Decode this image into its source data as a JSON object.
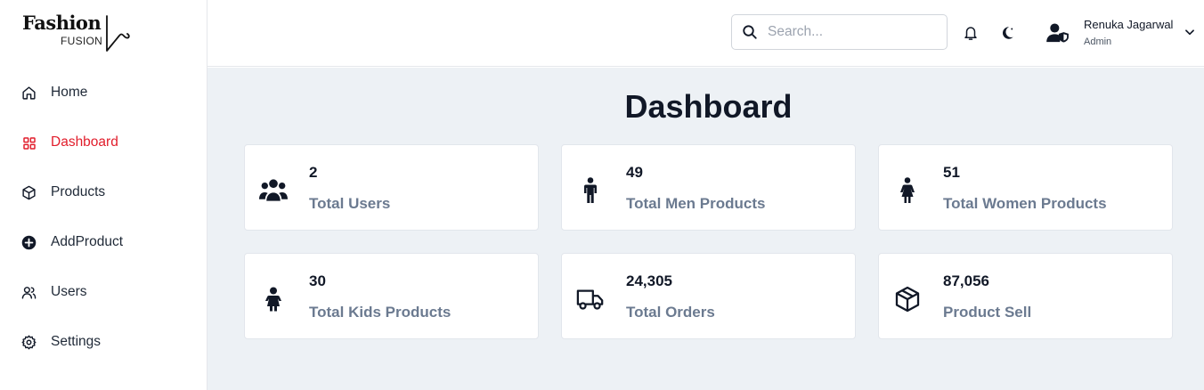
{
  "brand": {
    "name": "Fashion",
    "subtitle": "FUSION"
  },
  "sidebar": {
    "items": [
      {
        "label": "Home",
        "icon": "home-icon",
        "active": false
      },
      {
        "label": "Dashboard",
        "icon": "grid-icon",
        "active": true
      },
      {
        "label": "Products",
        "icon": "box-icon",
        "active": false
      },
      {
        "label": "AddProduct",
        "icon": "plus-circle-icon",
        "active": false
      },
      {
        "label": "Users",
        "icon": "users-icon",
        "active": false
      },
      {
        "label": "Settings",
        "icon": "gear-icon",
        "active": false
      }
    ]
  },
  "header": {
    "search": {
      "placeholder": "Search...",
      "value": ""
    },
    "user": {
      "name": "Renuka Jagarwal",
      "role": "Admin"
    }
  },
  "main": {
    "title": "Dashboard",
    "cards": [
      {
        "value": "2",
        "label": "Total Users",
        "icon": "users-group-icon"
      },
      {
        "value": "49",
        "label": "Total Men Products",
        "icon": "man-icon"
      },
      {
        "value": "51",
        "label": "Total Women Products",
        "icon": "woman-icon"
      },
      {
        "value": "30",
        "label": "Total Kids Products",
        "icon": "child-icon"
      },
      {
        "value": "24,305",
        "label": "Total Orders",
        "icon": "truck-icon"
      },
      {
        "value": "87,056",
        "label": "Product Sell",
        "icon": "cube-icon"
      }
    ]
  },
  "colors": {
    "accent": "#e11d2b",
    "main_bg": "#edf1f5",
    "card_label": "#6b7a90"
  }
}
